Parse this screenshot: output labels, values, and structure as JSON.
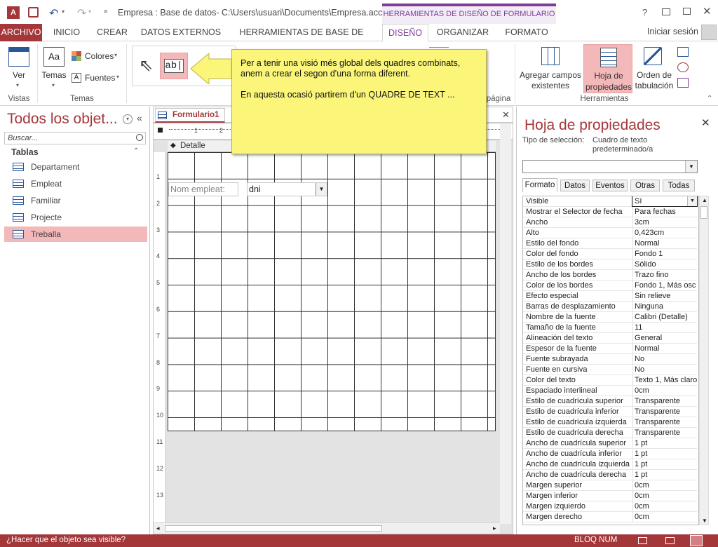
{
  "window": {
    "title": "Empresa : Base de datos- C:\\Users\\usuari\\Documents\\Empresa.acc...",
    "context_tab": "HERRAMIENTAS DE DISEÑO DE FORMULARIO",
    "help": "?",
    "user": "Iniciar sesión"
  },
  "tabs": [
    "ARCHIVO",
    "INICIO",
    "CREAR",
    "DATOS EXTERNOS",
    "HERRAMIENTAS DE BASE DE DATOS",
    "DISEÑO",
    "ORGANIZAR",
    "FORMATO"
  ],
  "ribbon": {
    "ver": "Ver",
    "vistas": "Vistas",
    "temas": "Temas",
    "colores": "Colores",
    "fuentes": "Fuentes",
    "temas_group": "Temas",
    "abl": "ab|",
    "pagina": "página",
    "agregar1": "Agregar campos",
    "agregar2": "existentes",
    "hoja1": "Hoja de",
    "hoja2": "propiedades",
    "orden1": "Orden de",
    "orden2": "tabulación",
    "herramientas": "Herramientas"
  },
  "callout": {
    "line1": "Per a tenir una visió més global dels quadres combinats,",
    "line2": "anem a crear el segon d'una forma diferent.",
    "line3": "En aquesta ocasió partirem d'un QUADRE DE TEXT ..."
  },
  "nav": {
    "title": "Todos los objet...",
    "search_placeholder": "Buscar...",
    "section": "Tablas",
    "items": [
      "Departament",
      "Empleat",
      "Familiar",
      "Projecte",
      "Treballa"
    ]
  },
  "doc": {
    "tab": "Formulario1",
    "section": "Detalle",
    "label": "Nom empleat:",
    "combo": "dni",
    "ruler_left": [
      "1",
      "2",
      "3",
      "4",
      "5",
      "6",
      "7",
      "8",
      "9",
      "10",
      "11",
      "12",
      "13"
    ],
    "ruler_top": [
      "1",
      "2"
    ]
  },
  "props": {
    "title": "Hoja de propiedades",
    "sel_label": "Tipo de selección:",
    "sel_value1": "Cuadro de texto",
    "sel_value2": "predeterminado/a",
    "tabs": [
      "Formato",
      "Datos",
      "Eventos",
      "Otras",
      "Todas"
    ],
    "rows": [
      [
        "Visible",
        "Sí"
      ],
      [
        "Mostrar el Selector de fecha",
        "Para fechas"
      ],
      [
        "Ancho",
        "3cm"
      ],
      [
        "Alto",
        "0,423cm"
      ],
      [
        "Estilo del fondo",
        "Normal"
      ],
      [
        "Color del fondo",
        "Fondo 1"
      ],
      [
        "Estilo de los bordes",
        "Sólido"
      ],
      [
        "Ancho de los bordes",
        "Trazo fino"
      ],
      [
        "Color de los bordes",
        "Fondo 1, Más osc"
      ],
      [
        "Efecto especial",
        "Sin relieve"
      ],
      [
        "Barras de desplazamiento",
        "Ninguna"
      ],
      [
        "Nombre de la fuente",
        "Calibri (Detalle)"
      ],
      [
        "Tamaño de la fuente",
        "11"
      ],
      [
        "Alineación del texto",
        "General"
      ],
      [
        "Espesor de la fuente",
        "Normal"
      ],
      [
        "Fuente subrayada",
        "No"
      ],
      [
        "Fuente en cursiva",
        "No"
      ],
      [
        "Color del texto",
        "Texto 1, Más claro"
      ],
      [
        "Espaciado interlineal",
        "0cm"
      ],
      [
        "Estilo de cuadrícula superior",
        "Transparente"
      ],
      [
        "Estilo de cuadrícula inferior",
        "Transparente"
      ],
      [
        "Estilo de cuadrícula izquierda",
        "Transparente"
      ],
      [
        "Estilo de cuadrícula derecha",
        "Transparente"
      ],
      [
        "Ancho de cuadrícula superior",
        "1 pt"
      ],
      [
        "Ancho de cuadrícula inferior",
        "1 pt"
      ],
      [
        "Ancho de cuadrícula izquierda",
        "1 pt"
      ],
      [
        "Ancho de cuadrícula derecha",
        "1 pt"
      ],
      [
        "Margen superior",
        "0cm"
      ],
      [
        "Margen inferior",
        "0cm"
      ],
      [
        "Margen izquierdo",
        "0cm"
      ],
      [
        "Margen derecho",
        "0cm"
      ]
    ]
  },
  "status": {
    "hint": "¿Hacer que el objeto sea visible?",
    "mode": "BLOQ NUM"
  },
  "colors": {
    "accent": "#a4373a",
    "context": "#7e3e98"
  }
}
